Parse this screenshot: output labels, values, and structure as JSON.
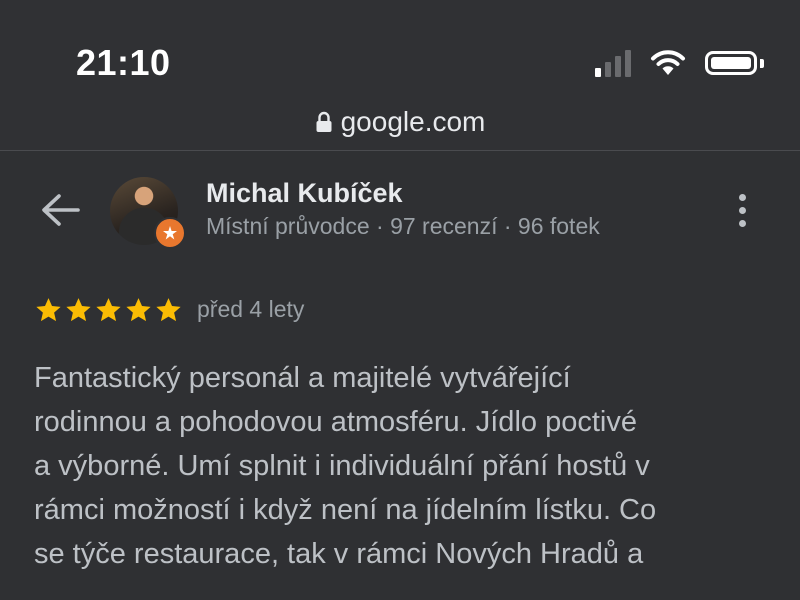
{
  "status_bar": {
    "time": "21:10",
    "icons": [
      "signal-icon",
      "wifi-icon",
      "battery-icon"
    ]
  },
  "url_bar": {
    "domain": "google.com",
    "icon": "lock-icon"
  },
  "reviewer": {
    "name": "Michal Kubíček",
    "meta": "Místní průvodce · 97 recenzí · 96 fotek",
    "badge_icon": "local-guide-badge-icon"
  },
  "review": {
    "rating": 5,
    "rating_max": 5,
    "date": "před 4 lety",
    "lines": [
      "Fantastický personál a majitelé vytvářející",
      "rodinnou a pohodovou atmosféru. Jídlo poctivé",
      "a výborné. Umí splnit i individuální přání hostů v",
      "rámci možností i když není na jídelním lístku. Co",
      "se týče restaurace, tak v rámci Nových Hradů a"
    ]
  },
  "colors": {
    "background": "#2f3033",
    "star": "#fbbc04",
    "badge": "#e8772e",
    "text_primary": "#e8eaed",
    "text_secondary": "#9aa0a6"
  }
}
